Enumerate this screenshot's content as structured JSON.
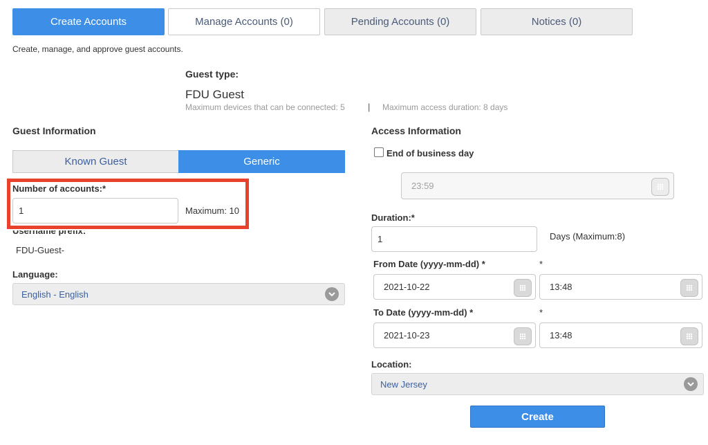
{
  "tabs": [
    {
      "label": "Create Accounts"
    },
    {
      "label": "Manage Accounts (0)"
    },
    {
      "label": "Pending Accounts (0)"
    },
    {
      "label": "Notices (0)"
    }
  ],
  "description": "Create, manage, and approve guest accounts.",
  "guest_type": {
    "heading": "Guest type:",
    "name": "FDU Guest",
    "max_devices": "Maximum devices that can be connected: 5",
    "separator": "|",
    "max_duration": "Maximum access duration: 8 days"
  },
  "guest_info": {
    "heading": "Guest Information",
    "toggle_known": "Known Guest",
    "toggle_generic": "Generic",
    "num_accounts_label": "Number of accounts:*",
    "num_accounts_value": "1",
    "num_accounts_max": "Maximum: 10",
    "username_prefix_label": "Username prefix:",
    "username_prefix_value": "FDU-Guest-",
    "language_label": "Language:",
    "language_value": "English - English"
  },
  "access_info": {
    "heading": "Access Information",
    "end_of_day_label": "End of business day",
    "end_of_day_time": "23:59",
    "duration_label": "Duration:*",
    "duration_value": "1",
    "duration_hint": "Days (Maximum:8)",
    "from_date_label": "From Date (yyyy-mm-dd) *",
    "from_time_label": "*",
    "from_date": "2021-10-22",
    "from_time": "13:48",
    "to_date_label": "To Date (yyyy-mm-dd) *",
    "to_time_label": "*",
    "to_date": "2021-10-23",
    "to_time": "13:48",
    "location_label": "Location:",
    "location_value": "New Jersey"
  },
  "create_label": "Create",
  "colors": {
    "accent": "#3d8ee6",
    "highlight": "#e8412c"
  }
}
